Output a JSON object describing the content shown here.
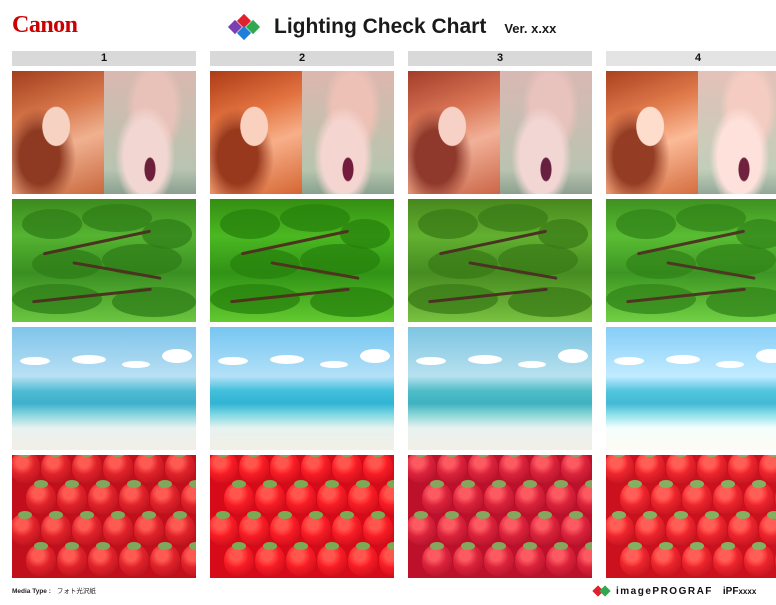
{
  "header": {
    "logo": "Canon",
    "title": "Lighting Check Chart",
    "version": "Ver. x.xx"
  },
  "columns": [
    {
      "label": "1"
    },
    {
      "label": "2"
    },
    {
      "label": "3"
    },
    {
      "label": "4"
    }
  ],
  "footer": {
    "media_type_label": "Media Type :",
    "media_type_value": "フォト光沢紙",
    "brand": "imagePROGRAF",
    "model_prefix": "iPF",
    "model_suffix": "xxxx"
  },
  "colors": {
    "logo_red": "#cc0000",
    "header_gray": "#d9d9d9",
    "diamond_red": "#e0202a",
    "diamond_blue": "#1e7fd8",
    "diamond_green": "#2fa84f",
    "diamond_purple": "#7a3fb0"
  }
}
